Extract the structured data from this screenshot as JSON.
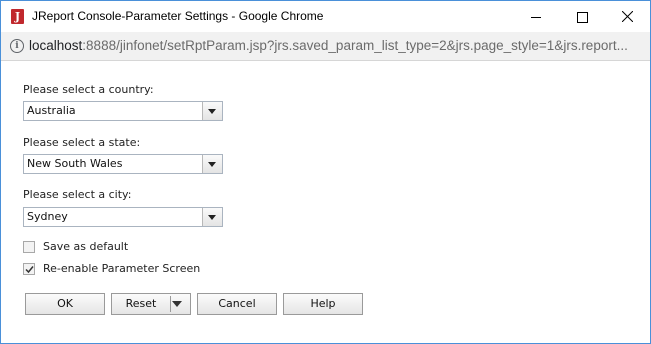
{
  "window": {
    "title": "JReport Console-Parameter Settings - Google Chrome",
    "app_icon_letter": "J"
  },
  "address": {
    "host": "localhost",
    "rest": ":8888/jinfonet/setRptParam.jsp?jrs.saved_param_list_type=2&jrs.page_style=1&jrs.report..."
  },
  "form": {
    "country": {
      "label": "Please select a country:",
      "value": "Australia"
    },
    "state": {
      "label": "Please select a state:",
      "value": "New South Wales"
    },
    "city": {
      "label": "Please select a city:",
      "value": "Sydney"
    },
    "save_default": {
      "label": "Save as default",
      "checked": false
    },
    "reenable": {
      "label": "Re-enable Parameter Screen",
      "checked": true
    }
  },
  "buttons": {
    "ok": "OK",
    "reset": "Reset",
    "cancel": "Cancel",
    "help": "Help"
  },
  "icons": {
    "app": "jreport-app-icon",
    "info": "info-icon",
    "minimize": "minimize-icon",
    "maximize": "maximize-icon",
    "close": "close-icon",
    "dropdown": "chevron-down-icon",
    "check": "checkmark-icon"
  }
}
